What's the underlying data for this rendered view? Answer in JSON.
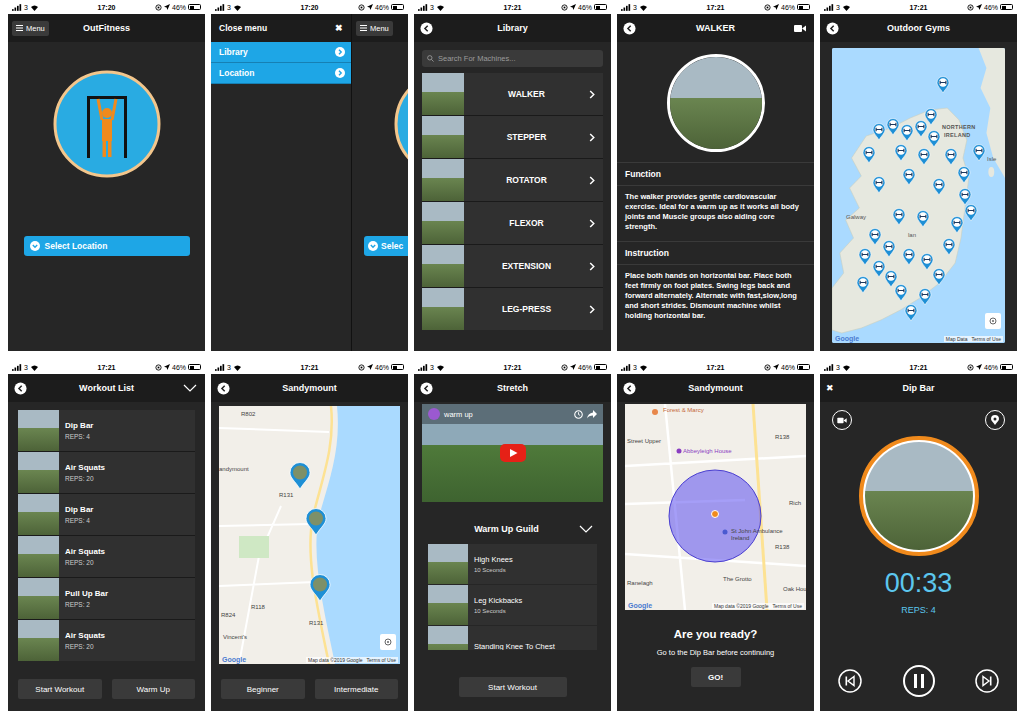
{
  "status_bar": {
    "carrier": "3",
    "battery": "46%",
    "battery_level": 0.46
  },
  "screens": [
    {
      "kind": "home",
      "time": "17:20",
      "menu_label": "Menu",
      "title": "OutFitness",
      "select_button": "Select Location"
    },
    {
      "kind": "side-menu",
      "time": "17:20",
      "close_label": "Close menu",
      "close_icon": "✖",
      "items": [
        "Library",
        "Location"
      ],
      "behind_menu_label": "Menu",
      "behind_button": "Selec"
    },
    {
      "kind": "library",
      "time": "17:21",
      "title": "Library",
      "search_placeholder": "Search For Machines...",
      "items": [
        "WALKER",
        "STEPPER",
        "ROTATOR",
        "FLEXOR",
        "EXTENSION",
        "LEG-PRESS"
      ]
    },
    {
      "kind": "machine",
      "time": "17:21",
      "title": "WALKER",
      "sections": [
        {
          "heading": "Function",
          "text": "The walker provides gentle cardiovascular exercise. Ideal for a warm up as it works all body joints and Muscle groups also aiding core strength."
        },
        {
          "heading": "Instruction",
          "text": "Place both hands on horizontal bar. Place both feet firmly on foot plates. Swing legs back and forward alternately. Alternate with fast,slow,long and short strides. Dismount machine whilst holding horizontal bar."
        }
      ]
    },
    {
      "kind": "gyms-map",
      "time": "17:21",
      "title": "Outdoor Gyms",
      "map_labels": [
        "NORTHERN",
        "IRELAND",
        "Isle",
        "Galway",
        "lan"
      ],
      "attribution": "Google",
      "map_links": [
        "Map Data",
        "Terms of Use"
      ]
    },
    {
      "kind": "workout-list",
      "time": "17:21",
      "title": "Workout List",
      "items": [
        {
          "name": "Dip Bar",
          "reps": "REPS: 4"
        },
        {
          "name": "Air Squats",
          "reps": "REPS: 20"
        },
        {
          "name": "Dip Bar",
          "reps": "REPS: 4"
        },
        {
          "name": "Air Squats",
          "reps": "REPS: 20"
        },
        {
          "name": "Pull Up Bar",
          "reps": "REPS: 2"
        },
        {
          "name": "Air Squats",
          "reps": "REPS: 20"
        }
      ],
      "buttons": [
        "Start Workout",
        "Warm Up"
      ]
    },
    {
      "kind": "workout-map",
      "time": "17:21",
      "title": "Sandymount",
      "map_labels": [
        "R802",
        "andymount",
        "R131",
        "R131",
        "R118",
        "R824",
        "Vincent's"
      ],
      "attribution": "Google",
      "map_links": [
        "Map data ©2019 Google",
        "Terms of Use"
      ],
      "buttons": [
        "Beginner",
        "Intermediate"
      ]
    },
    {
      "kind": "stretch",
      "time": "17:21",
      "title": "Stretch",
      "video_title": "warm up",
      "guide_title": "Warm Up Guild",
      "items": [
        {
          "name": "High Knees",
          "duration": "10 Sceonds"
        },
        {
          "name": "Leg Kickbacks",
          "duration": "10 Seconds"
        },
        {
          "name": "Standing Knee To Chest"
        }
      ],
      "button": "Start Workout"
    },
    {
      "kind": "ready",
      "time": "17:21",
      "title": "Sandymount",
      "map_labels": [
        "Forest & Marcy",
        "Street Upper",
        "Abbeyleigh House",
        "R138",
        "R138",
        "Rich",
        "St John Ambulance Ireland",
        "The Grotto",
        "Ranelagh",
        "Oak Hou"
      ],
      "attribution": "Google",
      "map_links": [
        "Map data ©2019 Google",
        "Terms of Use"
      ],
      "heading": "Are you ready?",
      "message": "Go to the Dip Bar before continuing",
      "button": "GO!"
    },
    {
      "kind": "timer",
      "time": "17:21",
      "close_icon": "✖",
      "title": "Dip Bar",
      "timer": "00:33",
      "reps": "REPS: 4"
    }
  ]
}
